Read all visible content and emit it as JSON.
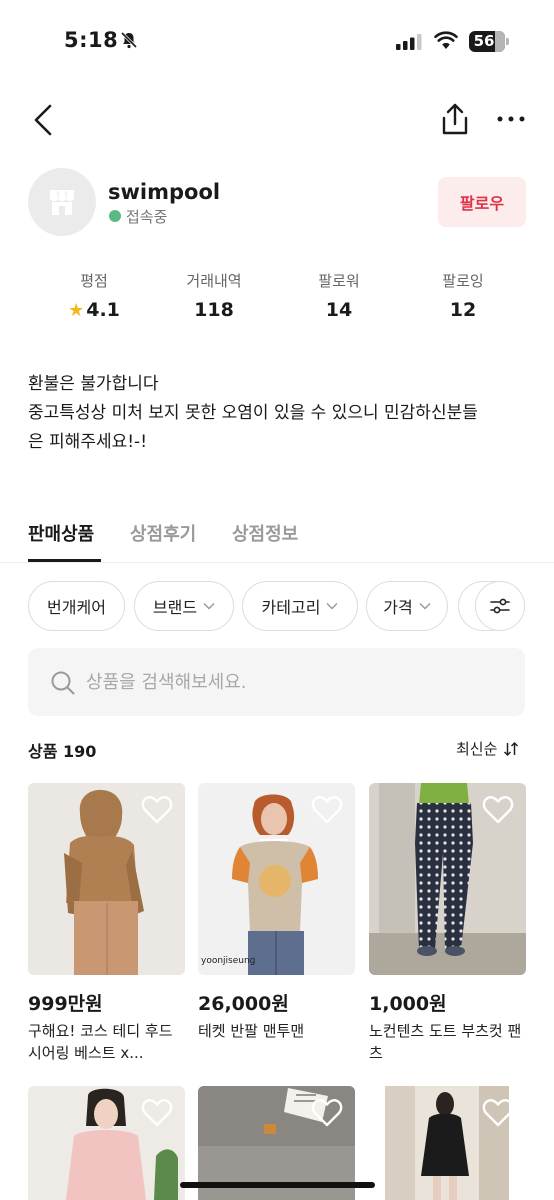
{
  "status_bar": {
    "time": "5:18",
    "battery": "56"
  },
  "profile": {
    "username": "swimpool",
    "status": "접속중",
    "follow_label": "팔로우"
  },
  "stats": [
    {
      "label": "평점",
      "value": "4.1"
    },
    {
      "label": "거래내역",
      "value": "118"
    },
    {
      "label": "팔로워",
      "value": "14"
    },
    {
      "label": "팔로잉",
      "value": "12"
    }
  ],
  "bio": {
    "line1": "환불은 불가합니다",
    "line2": "중고특성상 미처 보지 못한 오염이 있을 수 있으니 민감하신분들",
    "line3": "은 피해주세요!-!"
  },
  "tabs": [
    "판매상품",
    "상점후기",
    "상점정보"
  ],
  "filters": [
    "번개케어",
    "브랜드",
    "카테고리",
    "가격"
  ],
  "search": {
    "placeholder": "상품을 검색해보세요."
  },
  "products_header": {
    "label": "상품 190",
    "sort": "최신순"
  },
  "products": [
    {
      "price": "999만원",
      "name": "구해요! 코스 테디 후드 시어링 베스트 x..."
    },
    {
      "price": "26,000원",
      "name": "테켓 반팔 맨투맨"
    },
    {
      "price": "1,000원",
      "name": "노컨텐츠 도트 부츠컷 팬츠"
    }
  ],
  "image_text": {
    "product2_watermark": "yoonjiseung"
  }
}
